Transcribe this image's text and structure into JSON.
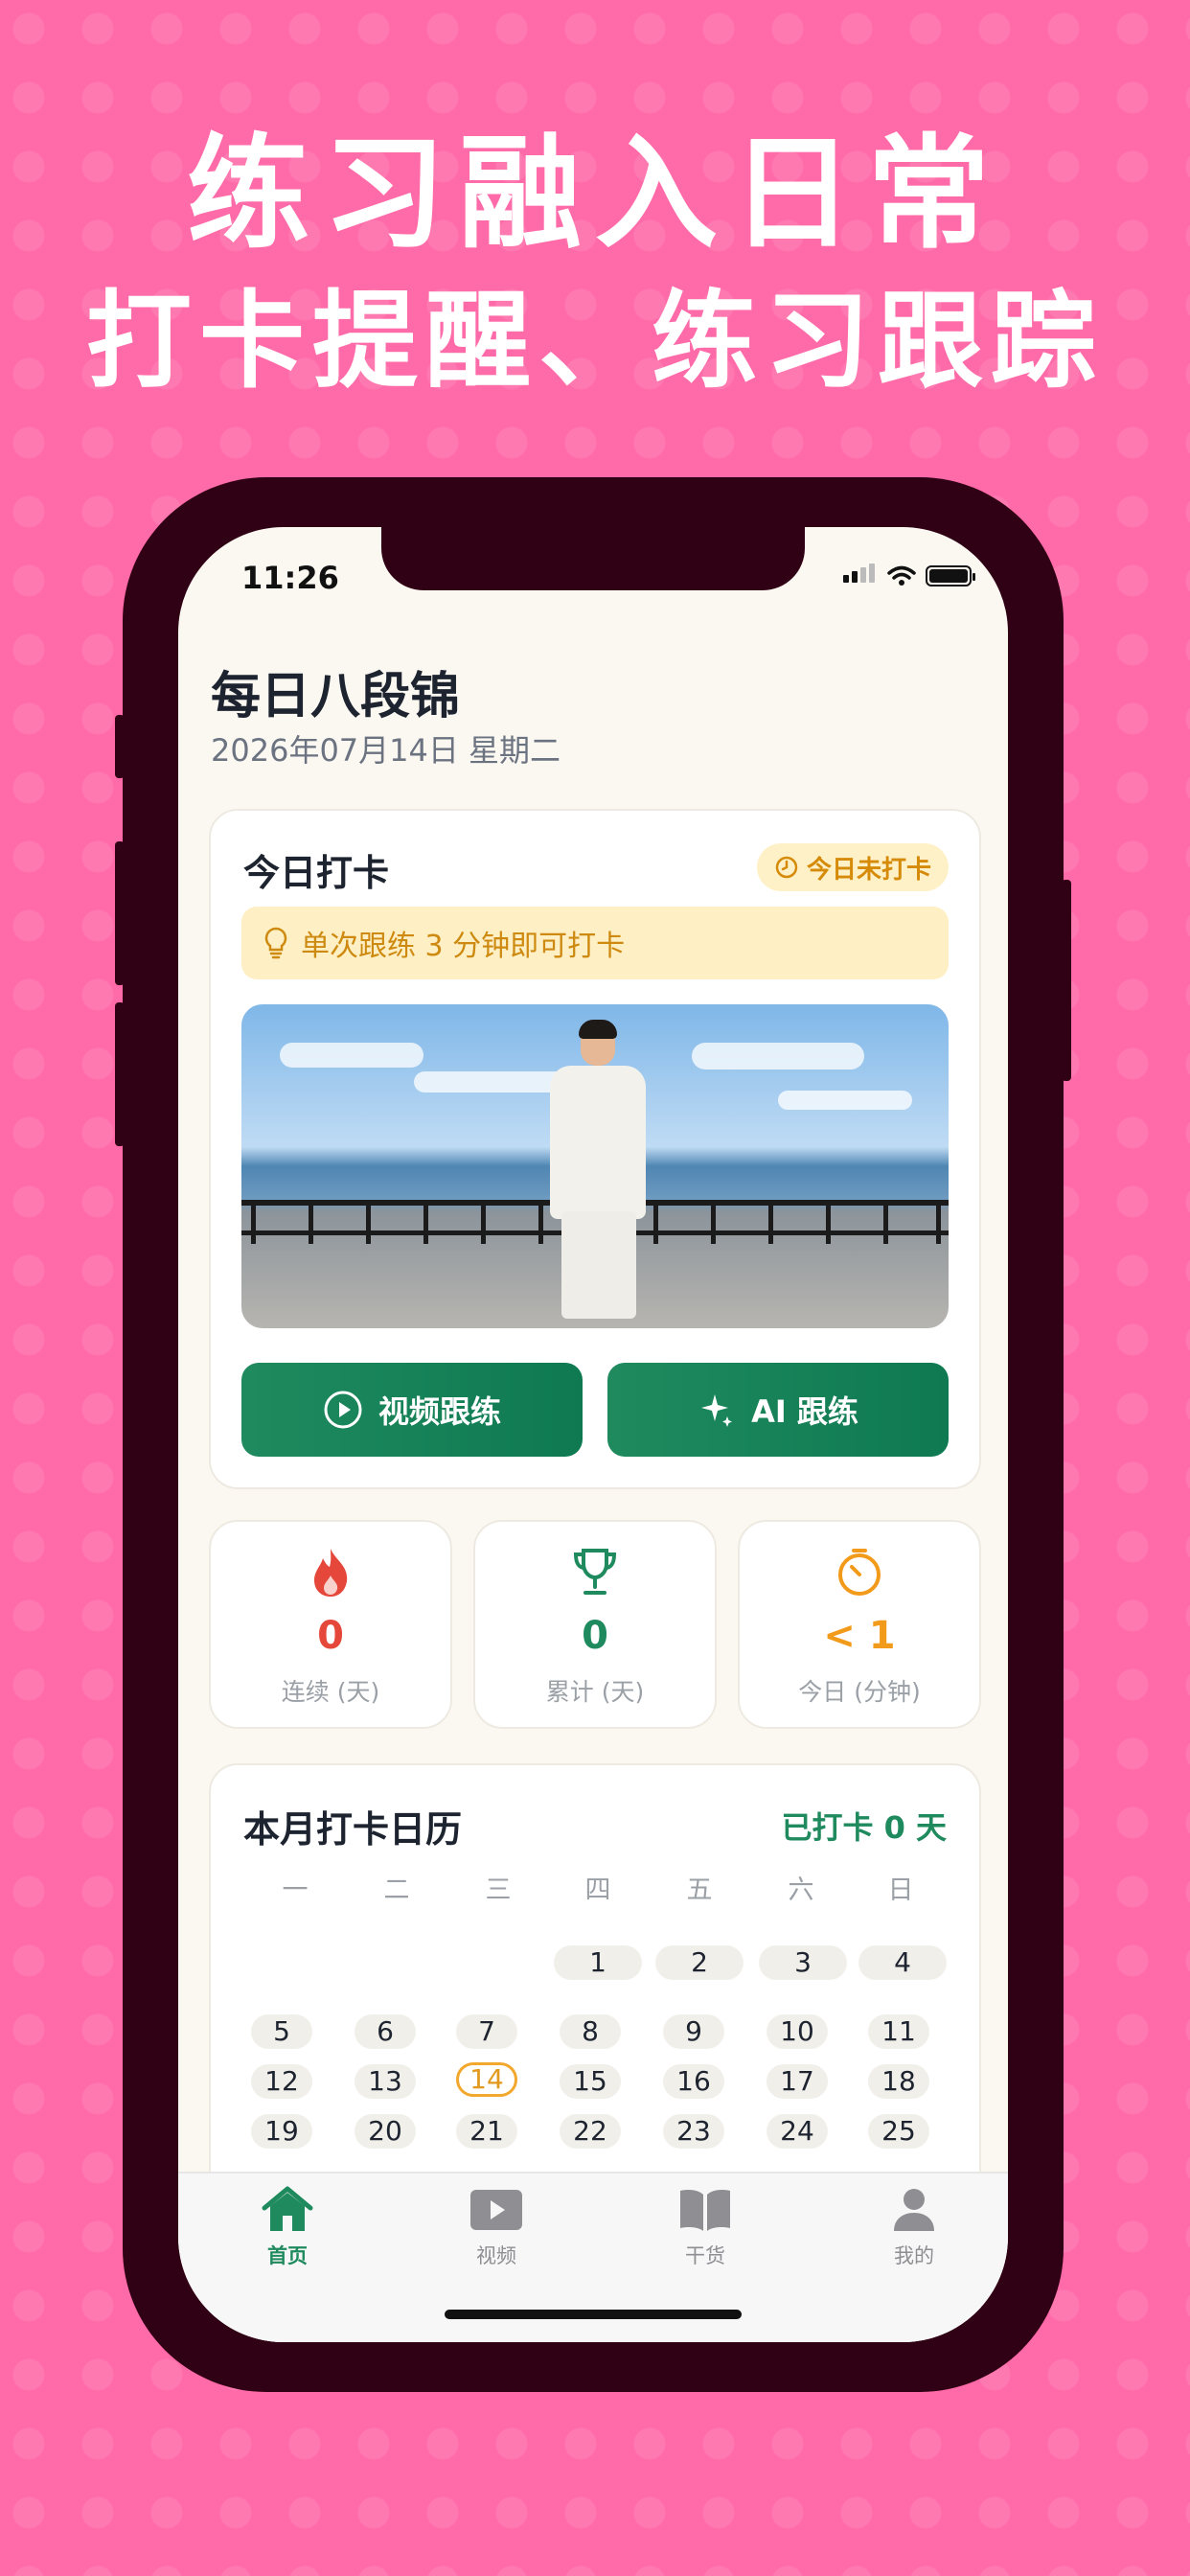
{
  "promo": {
    "headline": "练习融入日常",
    "subheadline": "打卡提醒、练习跟踪"
  },
  "status_bar": {
    "time": "11:26"
  },
  "header": {
    "title": "每日八段锦",
    "date": "2026年07月14日 星期二"
  },
  "checkin": {
    "title": "今日打卡",
    "status": "今日未打卡",
    "tip": "单次跟练 3 分钟即可打卡",
    "video_button": "视频跟练",
    "ai_button": "AI 跟练"
  },
  "stats": [
    {
      "value": "0",
      "label": "连续 (天)",
      "icon": "flame-icon",
      "color": "#E5483B"
    },
    {
      "value": "0",
      "label": "累计 (天)",
      "icon": "trophy-icon",
      "color": "#1F8A5E"
    },
    {
      "value": "< 1",
      "label": "今日 (分钟)",
      "icon": "timer-icon",
      "color": "#F29A1A"
    }
  ],
  "calendar": {
    "title": "本月打卡日历",
    "status": "已打卡 0 天",
    "weekdays": [
      "一",
      "二",
      "三",
      "四",
      "五",
      "六",
      "日"
    ],
    "today": 14,
    "days": [
      [
        "",
        "",
        "",
        "1",
        "2",
        "3",
        "4"
      ],
      [
        "5",
        "6",
        "7",
        "8",
        "9",
        "10",
        "11"
      ],
      [
        "12",
        "13",
        "14",
        "15",
        "16",
        "17",
        "18"
      ],
      [
        "19",
        "20",
        "21",
        "22",
        "23",
        "24",
        "25"
      ]
    ]
  },
  "tabs": [
    {
      "label": "首页",
      "icon": "home-icon",
      "active": true
    },
    {
      "label": "视频",
      "icon": "video-icon",
      "active": false
    },
    {
      "label": "干货",
      "icon": "book-icon",
      "active": false
    },
    {
      "label": "我的",
      "icon": "profile-icon",
      "active": false
    }
  ],
  "colors": {
    "background": "#FF6AA8",
    "brand": "#1F8A5E",
    "accent": "#F29A1A",
    "phone_frame": "#300114"
  }
}
